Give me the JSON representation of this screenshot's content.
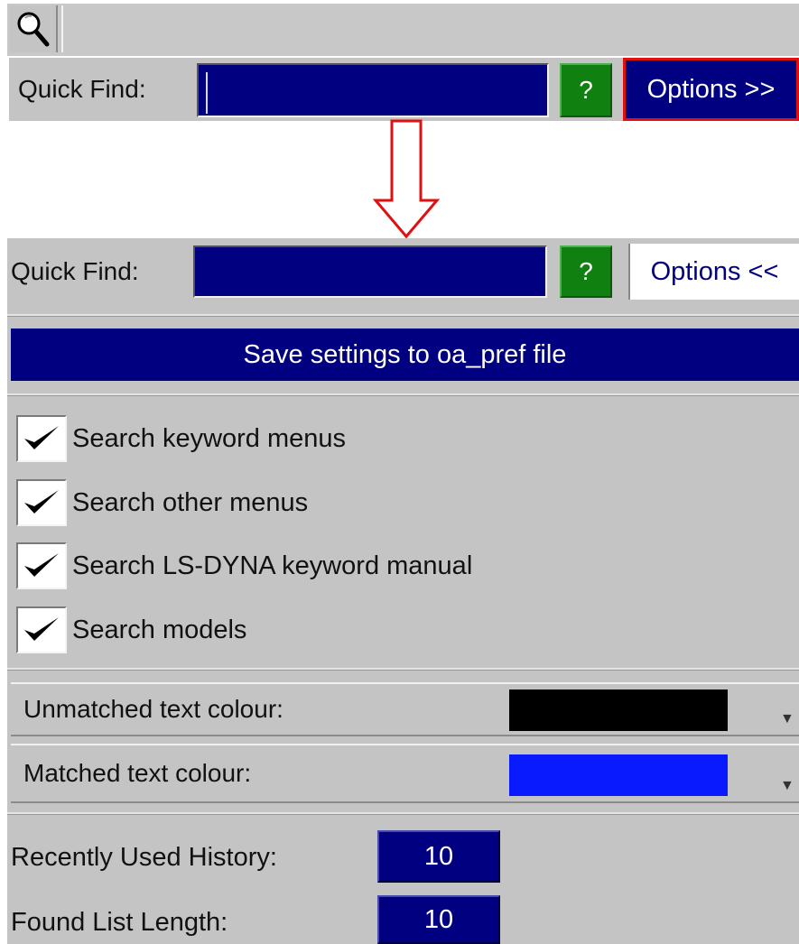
{
  "top_panel": {
    "search_icon": "magnifier-icon",
    "quick_find_label": "Quick Find:",
    "quick_find_value": "",
    "help_label": "?",
    "options_label": "Options >>",
    "options_highlight_color": "#e01010"
  },
  "arrow": {
    "icon": "down-arrow-icon",
    "color": "#e01010"
  },
  "expanded_panel": {
    "quick_find_label": "Quick Find:",
    "quick_find_value": "",
    "help_label": "?",
    "options_label": "Options <<",
    "save_button_label": "Save settings to oa_pref file",
    "checkboxes": [
      {
        "label": "Search keyword menus",
        "checked": true
      },
      {
        "label": "Search other menus",
        "checked": true
      },
      {
        "label": "Search LS-DYNA keyword manual",
        "checked": true
      },
      {
        "label": "Search models",
        "checked": true
      }
    ],
    "colours": [
      {
        "label": "Unmatched text colour:",
        "color": "#000000"
      },
      {
        "label": "Matched text colour:",
        "color": "#0a1aff"
      }
    ],
    "recently_used_history_label": "Recently Used History:",
    "recently_used_history_value": "10",
    "found_list_length_label": "Found List Length:",
    "found_list_length_value": "10"
  },
  "colors": {
    "panel_bg": "#c4c4c4",
    "navy": "#000080",
    "green": "#108010"
  }
}
